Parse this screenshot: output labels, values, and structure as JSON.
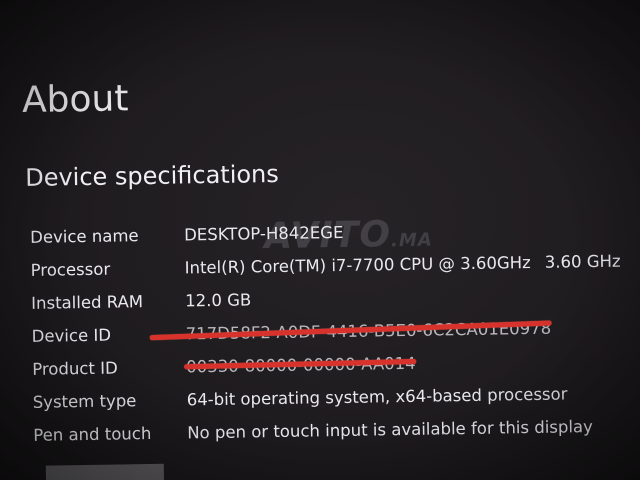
{
  "page": {
    "title": "About"
  },
  "device_specifications": {
    "heading": "Device specifications",
    "rows": [
      {
        "label": "Device name",
        "value": "DESKTOP-H842EGE"
      },
      {
        "label": "Processor",
        "value": "Intel(R) Core(TM) i7-7700 CPU @ 3.60GHz",
        "speed": "3.60 GHz"
      },
      {
        "label": "Installed RAM",
        "value": "12.0 GB"
      },
      {
        "label": "Device ID",
        "value": "717D58F2-A0DF-4416-B5E0-6C2CA01E0978"
      },
      {
        "label": "Product ID",
        "value": "00330-80000-00000-AA014"
      },
      {
        "label": "System type",
        "value": "64-bit operating system, x64-based processor"
      },
      {
        "label": "Pen and touch",
        "value": "No pen or touch input is available for this display"
      }
    ]
  },
  "watermark": {
    "text": "AVITO",
    "suffix": ".MA"
  },
  "colors": {
    "background": "#1d1b1d",
    "text": "#e9e8ed",
    "redaction": "#d8322d",
    "button": "#5a585c"
  }
}
